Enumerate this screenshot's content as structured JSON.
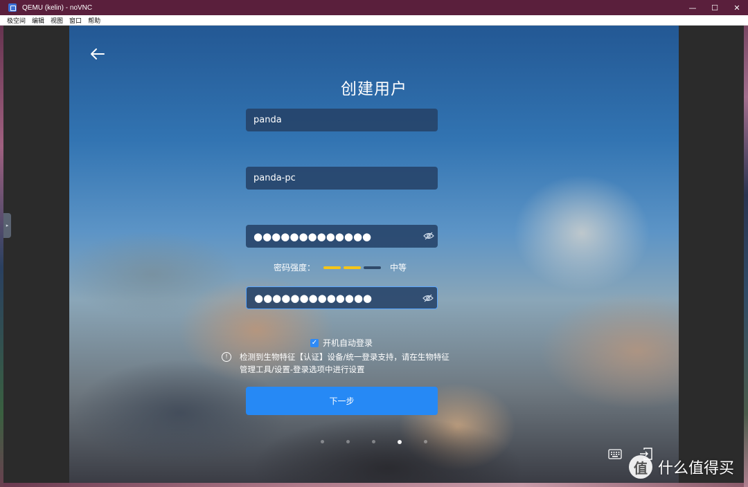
{
  "window": {
    "title": "QEMU (kelin) - noVNC",
    "controls": {
      "minimize": "—",
      "maximize": "☐",
      "close": "✕"
    }
  },
  "menu": [
    "极空间",
    "编辑",
    "视图",
    "窗口",
    "帮助"
  ],
  "form": {
    "title": "创建用户",
    "username": "panda",
    "hostname": "panda-pc",
    "password_mask": "●●●●●●●●●●●●●",
    "confirm_mask": "●●●●●●●●●●●●●",
    "strength_label": "密码强度：",
    "strength_level": "中等",
    "strength": {
      "filled": 2,
      "total": 3
    },
    "autologin_label": "开机自动登录",
    "autologin_checked": true,
    "notice": "检测到生物特征【认证】设备/统一登录支持，请在生物特征管理工具/设置-登录选项中进行设置",
    "next_label": "下一步"
  },
  "pager": {
    "total": 5,
    "active": 4
  },
  "colors": {
    "titlebar": "#5a1f3c",
    "accent": "#2689f5",
    "strength_on": "#f5c518",
    "strength_off": "#2f4a6a"
  },
  "icons": [
    "back-arrow-icon",
    "eye-icon",
    "info-icon",
    "keyboard-icon",
    "logout-icon",
    "side-panel-handle-icon"
  ],
  "watermark": {
    "logo_text": "值",
    "text": "什么值得买"
  }
}
